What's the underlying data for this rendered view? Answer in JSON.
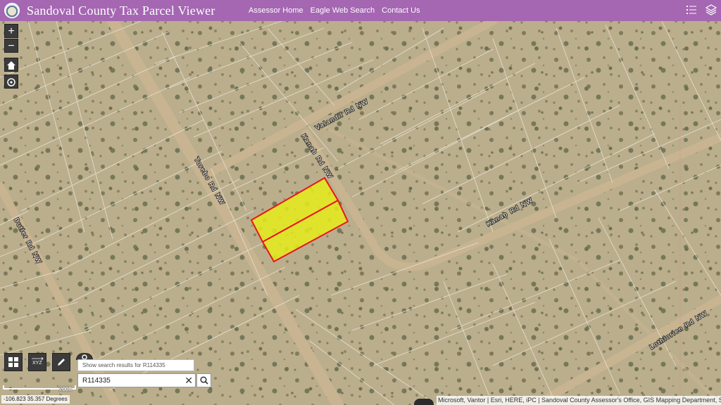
{
  "header": {
    "title": "Sandoval County Tax Parcel Viewer",
    "nav": [
      {
        "label": "Assessor Home"
      },
      {
        "label": "Eagle Web Search"
      },
      {
        "label": "Contact Us"
      }
    ]
  },
  "map": {
    "road_labels": [
      "Valandil Rd NW",
      "Kanab Rd NW",
      "Kanab Rd NW",
      "Torebo Rd NW",
      "Butler Rd NW",
      "Lothlorien Rd NW"
    ],
    "scale_label": "200ft",
    "coordinates": "-106.823 35.357 Degrees",
    "attribution": "Microsoft, Vantor | Esri, HERE, iPC | Sandoval County Assessor's Office, GIS Mapping Department, S"
  },
  "search": {
    "hint": "Show search results for R114335",
    "value": "R114335",
    "clear_symbol": "✕"
  },
  "controls": {
    "zoom_in": "+",
    "zoom_out": "−"
  },
  "colors": {
    "header": "#a566b2",
    "parcel_fill": "#e6ec1a",
    "parcel_outline": "#e8151b"
  }
}
